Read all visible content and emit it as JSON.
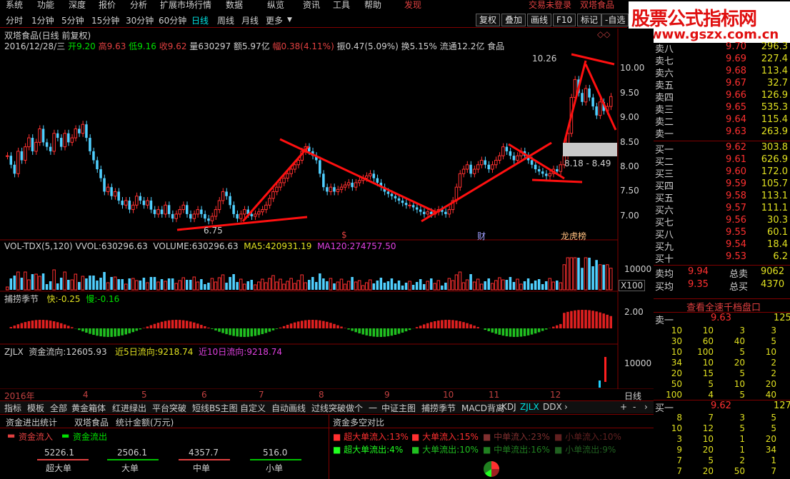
{
  "menu": [
    "系统",
    "功能",
    "深度",
    "报价",
    "分析",
    "扩展市场行情",
    "数据",
    "资讯",
    "帮助",
    "交易未登录",
    "双塔食品"
  ],
  "menu_hidden_items": [
    "纵览",
    "工具",
    "发现"
  ],
  "periods": [
    "分时",
    "1分钟",
    "5分钟",
    "15分钟",
    "30分钟",
    "60分钟",
    "日线",
    "周线",
    "月线",
    "更多"
  ],
  "selected_period": "日线",
  "right_buttons": [
    "复权",
    "叠加",
    "画线",
    "F10",
    "标记",
    "-自选"
  ],
  "logo": {
    "line1": "股票公式指标网",
    "line2": "www.gszx.com.cn"
  },
  "stock": {
    "title": "双塔食品(日线 前复权)",
    "date": "2016/12/28/三",
    "open_label": "开",
    "open": "9.20",
    "high_label": "高",
    "high": "9.63",
    "low_label": "低",
    "low": "9.16",
    "close_label": "收",
    "close": "9.62",
    "vol_label": "量",
    "vol": "630297",
    "amt_label": "额",
    "amt": "5.97亿",
    "chg_label": "幅",
    "chg": "0.38(4.11%)",
    "amp_label": "振",
    "amp": "0.47(5.09%)",
    "turn_label": "换",
    "turn": "5.15%",
    "float_label": "流通",
    "float": "12.2亿",
    "industry": "食品"
  },
  "price_axis": [
    "10.00",
    "9.50",
    "9.00",
    "8.50",
    "8.00",
    "7.50",
    "7.00"
  ],
  "annotations": {
    "high": "10.26",
    "low": "6.75",
    "range": "8.18 - 8.49",
    "ev1": "$",
    "ev2": "财",
    "ev3": "龙虎榜"
  },
  "volume": {
    "header": "VOL-TDX(5,120)",
    "vvol_label": "VVOL:",
    "vvol": "630296.63",
    "volume_label": "VOLUME:",
    "volume": "630296.63",
    "ma5_label": "MA5:",
    "ma5": "420931.19",
    "ma120_label": "MA120:",
    "ma120": "274757.50",
    "axis": "10000",
    "unit": "X100"
  },
  "season": {
    "name": "捕捞季节",
    "fast_label": "快:",
    "fast": "-0.25",
    "slow_label": "慢:",
    "slow": "-0.16",
    "axis": "2.00"
  },
  "zjlx": {
    "header": "ZJLX",
    "flow_label": "资金流向:",
    "flow": "12605.93",
    "flow5_label": "近5日流向:",
    "flow5": "9218.74",
    "flow10_label": "近10日流向:",
    "flow10": "9218.74",
    "axis": "10000"
  },
  "date_axis": [
    "2016年",
    "4",
    "5",
    "6",
    "7",
    "8",
    "9",
    "10",
    "11",
    "12"
  ],
  "date_axis_right": "日线",
  "tabs": [
    "指标",
    "模板",
    "全部",
    "黄金箱体",
    "红进绿出",
    "平台突破",
    "短线BS主图",
    "自定义",
    "自动画线",
    "过线突破做个",
    "一",
    "中证主图",
    "捕捞季节",
    "MACD背离",
    "KDJ",
    "ZJLX",
    "DDX"
  ],
  "orderbook": {
    "sells": [
      [
        "卖八",
        "9.70",
        "296.3"
      ],
      [
        "卖七",
        "9.69",
        "227.4"
      ],
      [
        "卖六",
        "9.68",
        "113.4"
      ],
      [
        "卖五",
        "9.67",
        "32.7"
      ],
      [
        "卖四",
        "9.66",
        "126.9"
      ],
      [
        "卖三",
        "9.65",
        "535.3"
      ],
      [
        "卖二",
        "9.64",
        "115.4"
      ],
      [
        "卖一",
        "9.63",
        "263.9"
      ]
    ],
    "buys": [
      [
        "买一",
        "9.62",
        "303.8"
      ],
      [
        "买二",
        "9.61",
        "626.9"
      ],
      [
        "买三",
        "9.60",
        "172.0"
      ],
      [
        "买四",
        "9.59",
        "105.7"
      ],
      [
        "买五",
        "9.58",
        "113.1"
      ],
      [
        "买六",
        "9.57",
        "111.1"
      ],
      [
        "买七",
        "9.56",
        "30.3"
      ],
      [
        "买八",
        "9.55",
        "60.1"
      ],
      [
        "买九",
        "9.54",
        "18.4"
      ],
      [
        "买十",
        "9.53",
        "6.2"
      ]
    ],
    "avg_sell_label": "卖均",
    "avg_sell": "9.94",
    "total_sell_label": "总卖",
    "total_sell": "9062",
    "avg_buy_label": "买均",
    "avg_buy": "9.35",
    "total_buy_label": "总买",
    "total_buy": "4370"
  },
  "depth": {
    "title": "查看全速千档盘口",
    "sell1_label": "卖一",
    "sell1_price": "9.63",
    "sell1_vol": "125",
    "sell_rows": [
      [
        "10",
        "10",
        "3",
        "3"
      ],
      [
        "30",
        "60",
        "40",
        "5"
      ],
      [
        "10",
        "100",
        "5",
        "10"
      ],
      [
        "34",
        "10",
        "20",
        "2"
      ],
      [
        "20",
        "15",
        "5",
        "2"
      ],
      [
        "50",
        "5",
        "10",
        "20"
      ],
      [
        "100",
        "4",
        "5",
        "40"
      ]
    ],
    "buy1_label": "买一",
    "buy1_price": "9.62",
    "buy1_vol": "127",
    "buy_rows": [
      [
        "8",
        "7",
        "3",
        "5"
      ],
      [
        "10",
        "12",
        "5",
        "5"
      ],
      [
        "3",
        "10",
        "1",
        "20"
      ],
      [
        "9",
        "20",
        "1",
        "34"
      ],
      [
        "7",
        "5",
        "2",
        "1"
      ],
      [
        "7",
        "20",
        "50",
        "7"
      ]
    ]
  },
  "fund_stats": {
    "title": "资金进出统计",
    "stock": "双塔食品",
    "unit": "统计金额(万元)",
    "in_label": "资金流入",
    "out_label": "资金流出",
    "values": [
      "5226.1",
      "2506.1",
      "4357.7",
      "516.0"
    ],
    "cats": [
      "超大单",
      "大单",
      "中单",
      "小单"
    ]
  },
  "fund_compare": {
    "title": "资金多空对比",
    "rows": [
      [
        [
          "超大单流入:",
          "13%"
        ],
        [
          "大单流入:",
          "15%"
        ],
        [
          "中单流入:",
          "23%"
        ],
        [
          "小单流入:",
          "10%"
        ]
      ],
      [
        [
          "超大单流出:",
          "4%"
        ],
        [
          "大单流出:",
          "10%"
        ],
        [
          "中单流出:",
          "16%"
        ],
        [
          "小单流出:",
          "9%"
        ]
      ]
    ]
  },
  "chart_data": {
    "type": "candlestick",
    "y_range": [
      6.6,
      10.5
    ],
    "closes": [
      8.3,
      8.1,
      7.9,
      8.4,
      8.2,
      8.5,
      8.7,
      8.4,
      8.6,
      8.9,
      8.6,
      8.5,
      8.4,
      8.8,
      8.7,
      8.5,
      8.8,
      8.6,
      8.7,
      8.9,
      8.8,
      9.0,
      8.7,
      8.4,
      8.2,
      8.0,
      7.8,
      7.5,
      7.6,
      7.4,
      7.5,
      7.3,
      7.2,
      7.3,
      7.1,
      7.2,
      7.4,
      7.3,
      7.2,
      7.3,
      7.1,
      7.0,
      7.1,
      7.0,
      7.2,
      7.0,
      6.9,
      7.0,
      7.1,
      7.2,
      7.0,
      6.9,
      7.0,
      7.1,
      7.0,
      6.9,
      6.85,
      6.95,
      7.1,
      7.3,
      7.5,
      7.4,
      7.2,
      7.0,
      6.9,
      7.0,
      7.1,
      7.0,
      6.95,
      7.0,
      7.05,
      7.1,
      7.2,
      7.35,
      7.5,
      7.6,
      7.7,
      7.8,
      7.9,
      8.0,
      8.1,
      8.2,
      8.4,
      8.5,
      8.4,
      8.3,
      8.2,
      7.9,
      7.6,
      7.5,
      7.6,
      7.5,
      7.55,
      7.6,
      7.65,
      7.7,
      7.6,
      7.7,
      7.75,
      7.8,
      7.85,
      7.9,
      7.8,
      7.7,
      7.6,
      7.5,
      7.45,
      7.4,
      7.35,
      7.3,
      7.25,
      7.2,
      7.2,
      7.15,
      7.1,
      7.05,
      7.0,
      7.05,
      7.0,
      7.05,
      7.1,
      7.05,
      7.0,
      7.1,
      7.3,
      7.6,
      7.9,
      8.0,
      8.1,
      7.9,
      8.0,
      8.1,
      8.2,
      8.1,
      8.0,
      8.1,
      8.2,
      8.3,
      8.5,
      8.4,
      8.3,
      8.2,
      8.3,
      8.4,
      8.3,
      8.2,
      8.1,
      8.0,
      7.95,
      7.9,
      7.85,
      7.9,
      8.0,
      7.95,
      8.1,
      8.3,
      8.8,
      9.6,
      10.0,
      9.7,
      9.5,
      9.8,
      9.6,
      9.4,
      9.2,
      9.5,
      9.3,
      9.4,
      9.62
    ]
  }
}
